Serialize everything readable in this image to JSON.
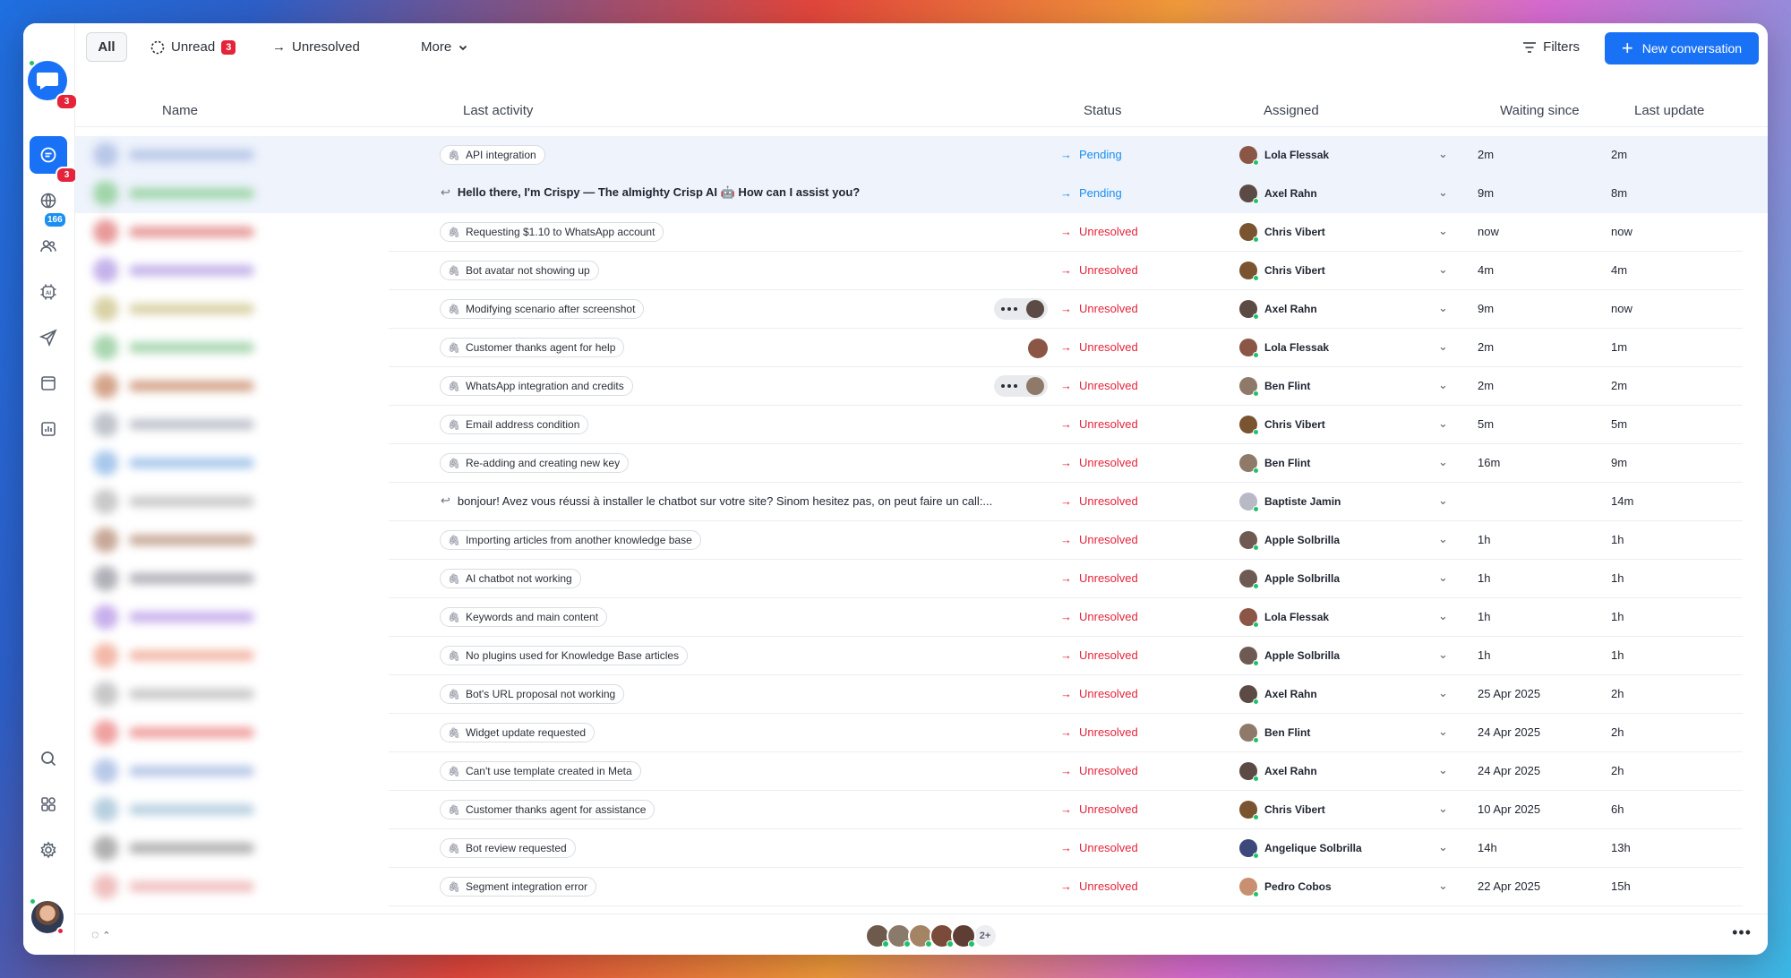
{
  "sidebar": {
    "logo_badge": "3",
    "inbox_badge": "3",
    "globe_badge": "166",
    "items": [
      {
        "icon": "chat-icon",
        "active": true
      },
      {
        "icon": "globe-icon"
      },
      {
        "icon": "people-icon"
      },
      {
        "icon": "ai-chip-icon"
      },
      {
        "icon": "send-icon"
      },
      {
        "icon": "calendar-icon"
      },
      {
        "icon": "chart-icon"
      }
    ],
    "bottom_items": [
      {
        "icon": "search-icon"
      },
      {
        "icon": "apps-icon"
      },
      {
        "icon": "gear-icon"
      }
    ]
  },
  "topbar": {
    "all_label": "All",
    "unread_label": "Unread",
    "unread_count": "3",
    "unresolved_label": "Unresolved",
    "more_label": "More",
    "filters_label": "Filters",
    "new_conversation_label": "New conversation"
  },
  "columns": {
    "name": "Name",
    "last_activity": "Last activity",
    "status": "Status",
    "assigned": "Assigned",
    "waiting_since": "Waiting since",
    "last_update": "Last update"
  },
  "rows": [
    {
      "kind": "tag",
      "activity": "API integration",
      "status": "Pending",
      "status_type": "pending",
      "agent": "Lola Flessak",
      "waiting": "2m",
      "updated": "2m",
      "highlight": true
    },
    {
      "kind": "reply",
      "activity": "Hello there, I'm Crispy — The almighty Crisp AI 🤖 How can I assist you?",
      "bold": true,
      "status": "Pending",
      "status_type": "pending",
      "agent": "Axel Rahn",
      "waiting": "9m",
      "updated": "8m",
      "highlight": true
    },
    {
      "kind": "tag",
      "activity": "Requesting $1.10 to WhatsApp account",
      "status": "Unresolved",
      "status_type": "unresolved",
      "agent": "Chris Vibert",
      "waiting": "now",
      "updated": "now"
    },
    {
      "kind": "tag",
      "activity": "Bot avatar not showing up",
      "status": "Unresolved",
      "status_type": "unresolved",
      "agent": "Chris Vibert",
      "waiting": "4m",
      "updated": "4m"
    },
    {
      "kind": "tag",
      "activity": "Modifying scenario after screenshot",
      "typing": true,
      "status": "Unresolved",
      "status_type": "unresolved",
      "agent": "Axel Rahn",
      "waiting": "9m",
      "updated": "now"
    },
    {
      "kind": "tag",
      "activity": "Customer thanks agent for help",
      "viewer": true,
      "status": "Unresolved",
      "status_type": "unresolved",
      "agent": "Lola Flessak",
      "waiting": "2m",
      "updated": "1m"
    },
    {
      "kind": "tag",
      "activity": "WhatsApp integration and credits",
      "typing": true,
      "status": "Unresolved",
      "status_type": "unresolved",
      "agent": "Ben Flint",
      "waiting": "2m",
      "updated": "2m"
    },
    {
      "kind": "tag",
      "activity": "Email address condition",
      "status": "Unresolved",
      "status_type": "unresolved",
      "agent": "Chris Vibert",
      "waiting": "5m",
      "updated": "5m"
    },
    {
      "kind": "tag",
      "activity": "Re-adding and creating new key",
      "status": "Unresolved",
      "status_type": "unresolved",
      "agent": "Ben Flint",
      "waiting": "16m",
      "updated": "9m"
    },
    {
      "kind": "reply",
      "activity": "bonjour! Avez vous réussi à installer le chatbot sur votre site? Sinom hesitez pas, on peut faire un call:...",
      "bold": false,
      "status": "Unresolved",
      "status_type": "unresolved",
      "agent": "Baptiste Jamin",
      "waiting": "",
      "updated": "14m"
    },
    {
      "kind": "tag",
      "activity": "Importing articles from another knowledge base",
      "status": "Unresolved",
      "status_type": "unresolved",
      "agent": "Apple Solbrilla",
      "waiting": "1h",
      "updated": "1h"
    },
    {
      "kind": "tag",
      "activity": "AI chatbot not working",
      "status": "Unresolved",
      "status_type": "unresolved",
      "agent": "Apple Solbrilla",
      "waiting": "1h",
      "updated": "1h"
    },
    {
      "kind": "tag",
      "activity": "Keywords and main content",
      "status": "Unresolved",
      "status_type": "unresolved",
      "agent": "Lola Flessak",
      "waiting": "1h",
      "updated": "1h"
    },
    {
      "kind": "tag",
      "activity": "No plugins used for Knowledge Base articles",
      "status": "Unresolved",
      "status_type": "unresolved",
      "agent": "Apple Solbrilla",
      "waiting": "1h",
      "updated": "1h"
    },
    {
      "kind": "tag",
      "activity": "Bot's URL proposal not working",
      "status": "Unresolved",
      "status_type": "unresolved",
      "agent": "Axel Rahn",
      "waiting": "25 Apr 2025",
      "updated": "2h"
    },
    {
      "kind": "tag",
      "activity": "Widget update requested",
      "status": "Unresolved",
      "status_type": "unresolved",
      "agent": "Ben Flint",
      "waiting": "24 Apr 2025",
      "updated": "2h"
    },
    {
      "kind": "tag",
      "activity": "Can't use template created in Meta",
      "status": "Unresolved",
      "status_type": "unresolved",
      "agent": "Axel Rahn",
      "waiting": "24 Apr 2025",
      "updated": "2h"
    },
    {
      "kind": "tag",
      "activity": "Customer thanks agent for assistance",
      "status": "Unresolved",
      "status_type": "unresolved",
      "agent": "Chris Vibert",
      "waiting": "10 Apr 2025",
      "updated": "6h"
    },
    {
      "kind": "tag",
      "activity": "Bot review requested",
      "status": "Unresolved",
      "status_type": "unresolved",
      "agent": "Angelique Solbrilla",
      "waiting": "14h",
      "updated": "13h"
    },
    {
      "kind": "tag",
      "activity": "Segment integration error",
      "status": "Unresolved",
      "status_type": "unresolved",
      "agent": "Pedro Cobos",
      "waiting": "22 Apr 2025",
      "updated": "15h"
    }
  ],
  "footer": {
    "team_more": "2+",
    "options_label": "•••"
  },
  "colors": {
    "accent": "#1972f5",
    "pending": "#1b8ff0",
    "unresolved": "#e5243b",
    "online": "#1fc26a"
  }
}
